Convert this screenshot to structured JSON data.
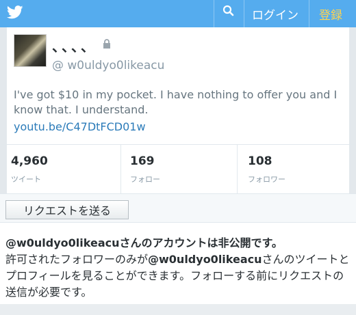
{
  "topbar": {
    "bird_icon": "twitter-bird-icon",
    "search_icon": "search-icon",
    "login_label": "ログイン",
    "signup_label": "登録",
    "bg_color": "#55acee",
    "signup_color": "#ffd34e"
  },
  "profile": {
    "name": "、、、、",
    "lock_icon": "lock-icon",
    "handle": "@ w0uldyo0likeacu",
    "bio": "I've got $10 in my pocket. I have nothing to offer you and I know that. I understand.",
    "link": "youtu.be/C47DtFCD01w"
  },
  "stats": [
    {
      "value": "4,960",
      "label": "ツイート"
    },
    {
      "value": "169",
      "label": "フォロー"
    },
    {
      "value": "108",
      "label": "フォロワー"
    }
  ],
  "request_button": "リクエストを送る",
  "private_notice": {
    "title_user": "@w0uldyo0likeacu",
    "title_rest": "さんのアカウントは非公開です。",
    "body_pre": "許可されたフォロワーのみが",
    "body_user": "@w0uldyo0likeacu",
    "body_post": "さんのツイートとプロフィールを見ることができます。フォローする前にリクエストの送信が必要です。"
  }
}
